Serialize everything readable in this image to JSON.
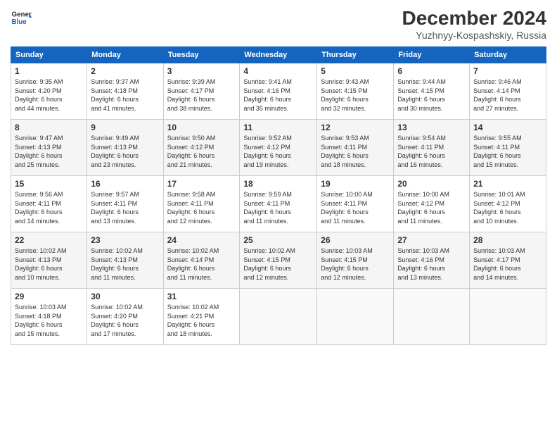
{
  "header": {
    "logo_line1": "General",
    "logo_line2": "Blue",
    "title": "December 2024",
    "subtitle": "Yuzhnyy-Kospashskiy, Russia"
  },
  "columns": [
    "Sunday",
    "Monday",
    "Tuesday",
    "Wednesday",
    "Thursday",
    "Friday",
    "Saturday"
  ],
  "weeks": [
    [
      {
        "day": "1",
        "info": "Sunrise: 9:35 AM\nSunset: 4:20 PM\nDaylight: 6 hours\nand 44 minutes."
      },
      {
        "day": "2",
        "info": "Sunrise: 9:37 AM\nSunset: 4:18 PM\nDaylight: 6 hours\nand 41 minutes."
      },
      {
        "day": "3",
        "info": "Sunrise: 9:39 AM\nSunset: 4:17 PM\nDaylight: 6 hours\nand 38 minutes."
      },
      {
        "day": "4",
        "info": "Sunrise: 9:41 AM\nSunset: 4:16 PM\nDaylight: 6 hours\nand 35 minutes."
      },
      {
        "day": "5",
        "info": "Sunrise: 9:43 AM\nSunset: 4:15 PM\nDaylight: 6 hours\nand 32 minutes."
      },
      {
        "day": "6",
        "info": "Sunrise: 9:44 AM\nSunset: 4:15 PM\nDaylight: 6 hours\nand 30 minutes."
      },
      {
        "day": "7",
        "info": "Sunrise: 9:46 AM\nSunset: 4:14 PM\nDaylight: 6 hours\nand 27 minutes."
      }
    ],
    [
      {
        "day": "8",
        "info": "Sunrise: 9:47 AM\nSunset: 4:13 PM\nDaylight: 6 hours\nand 25 minutes."
      },
      {
        "day": "9",
        "info": "Sunrise: 9:49 AM\nSunset: 4:13 PM\nDaylight: 6 hours\nand 23 minutes."
      },
      {
        "day": "10",
        "info": "Sunrise: 9:50 AM\nSunset: 4:12 PM\nDaylight: 6 hours\nand 21 minutes."
      },
      {
        "day": "11",
        "info": "Sunrise: 9:52 AM\nSunset: 4:12 PM\nDaylight: 6 hours\nand 19 minutes."
      },
      {
        "day": "12",
        "info": "Sunrise: 9:53 AM\nSunset: 4:11 PM\nDaylight: 6 hours\nand 18 minutes."
      },
      {
        "day": "13",
        "info": "Sunrise: 9:54 AM\nSunset: 4:11 PM\nDaylight: 6 hours\nand 16 minutes."
      },
      {
        "day": "14",
        "info": "Sunrise: 9:55 AM\nSunset: 4:11 PM\nDaylight: 6 hours\nand 15 minutes."
      }
    ],
    [
      {
        "day": "15",
        "info": "Sunrise: 9:56 AM\nSunset: 4:11 PM\nDaylight: 6 hours\nand 14 minutes."
      },
      {
        "day": "16",
        "info": "Sunrise: 9:57 AM\nSunset: 4:11 PM\nDaylight: 6 hours\nand 13 minutes."
      },
      {
        "day": "17",
        "info": "Sunrise: 9:58 AM\nSunset: 4:11 PM\nDaylight: 6 hours\nand 12 minutes."
      },
      {
        "day": "18",
        "info": "Sunrise: 9:59 AM\nSunset: 4:11 PM\nDaylight: 6 hours\nand 11 minutes."
      },
      {
        "day": "19",
        "info": "Sunrise: 10:00 AM\nSunset: 4:11 PM\nDaylight: 6 hours\nand 11 minutes."
      },
      {
        "day": "20",
        "info": "Sunrise: 10:00 AM\nSunset: 4:12 PM\nDaylight: 6 hours\nand 11 minutes."
      },
      {
        "day": "21",
        "info": "Sunrise: 10:01 AM\nSunset: 4:12 PM\nDaylight: 6 hours\nand 10 minutes."
      }
    ],
    [
      {
        "day": "22",
        "info": "Sunrise: 10:02 AM\nSunset: 4:13 PM\nDaylight: 6 hours\nand 10 minutes."
      },
      {
        "day": "23",
        "info": "Sunrise: 10:02 AM\nSunset: 4:13 PM\nDaylight: 6 hours\nand 11 minutes."
      },
      {
        "day": "24",
        "info": "Sunrise: 10:02 AM\nSunset: 4:14 PM\nDaylight: 6 hours\nand 11 minutes."
      },
      {
        "day": "25",
        "info": "Sunrise: 10:02 AM\nSunset: 4:15 PM\nDaylight: 6 hours\nand 12 minutes."
      },
      {
        "day": "26",
        "info": "Sunrise: 10:03 AM\nSunset: 4:15 PM\nDaylight: 6 hours\nand 12 minutes."
      },
      {
        "day": "27",
        "info": "Sunrise: 10:03 AM\nSunset: 4:16 PM\nDaylight: 6 hours\nand 13 minutes."
      },
      {
        "day": "28",
        "info": "Sunrise: 10:03 AM\nSunset: 4:17 PM\nDaylight: 6 hours\nand 14 minutes."
      }
    ],
    [
      {
        "day": "29",
        "info": "Sunrise: 10:03 AM\nSunset: 4:18 PM\nDaylight: 6 hours\nand 15 minutes."
      },
      {
        "day": "30",
        "info": "Sunrise: 10:02 AM\nSunset: 4:20 PM\nDaylight: 6 hours\nand 17 minutes."
      },
      {
        "day": "31",
        "info": "Sunrise: 10:02 AM\nSunset: 4:21 PM\nDaylight: 6 hours\nand 18 minutes."
      },
      null,
      null,
      null,
      null
    ]
  ]
}
